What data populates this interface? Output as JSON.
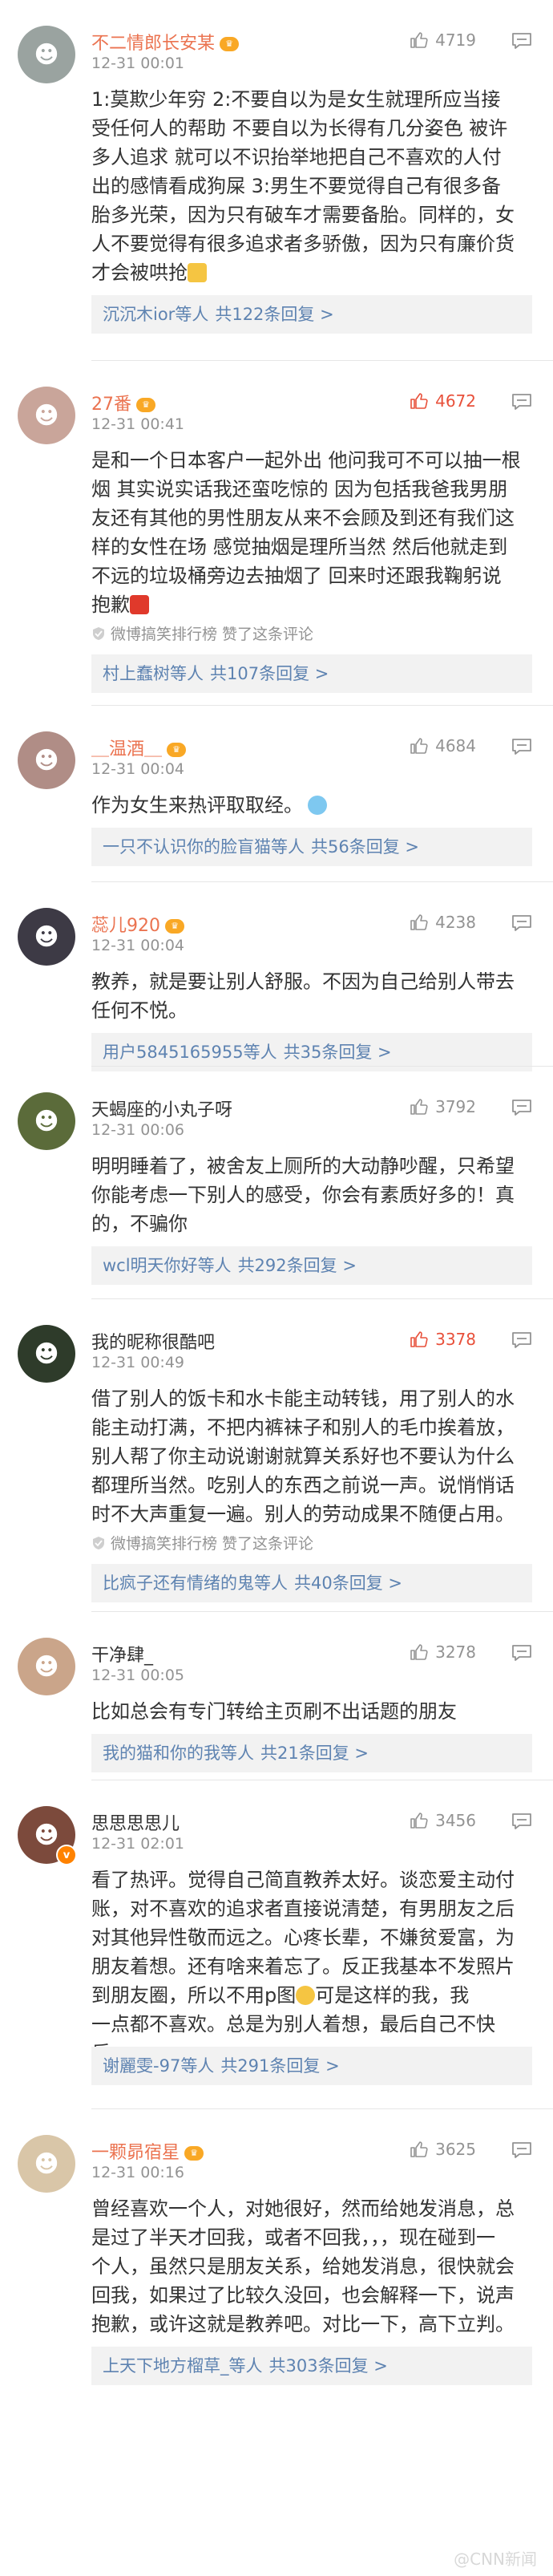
{
  "comments": [
    {
      "name": "不二情郎长安某",
      "time": "12-31 00:01",
      "likes": "4719",
      "hot": false,
      "name_color": "orange",
      "avatar_color": "#9aa3a0",
      "lines": [
        "1:莫欺少年穷   2:不要自以为是女生就理所应当接",
        "受任何人的帮助 不要自以为长得有几分姿色 被许",
        "多人追求 就可以不识抬举地把自己不喜欢的人付",
        "出的感情看成狗屎 3:男生不要觉得自己有很多备",
        "胎多光荣，因为只有破车才需要备胎。同样的，女",
        "人不要觉得有很多追求者多骄傲，因为只有廉价货",
        "才会被哄抢"
      ],
      "via": "",
      "reply_who": "沉沉木ior",
      "reply_mid": "等人",
      "reply_more": "共122条回复 >"
    },
    {
      "name": "27番",
      "time": "12-31 00:41",
      "likes": "4672",
      "hot": true,
      "name_color": "orange",
      "avatar_color": "#c9a59a",
      "lines": [
        "是和一个日本客户一起外出 他问我可不可以抽一根",
        "烟 其实说实话我还蛮吃惊的 因为包括我爸我男朋",
        "友还有其他的男性朋友从来不会顾及到还有我们这",
        "样的女性在场 感觉抽烟是理所当然 然后他就走到",
        "不远的垃圾桶旁边去抽烟了 回来时还跟我鞠躬说",
        "抱歉"
      ],
      "via": "微博搞笑排行榜 赞了这条评论",
      "reply_who": "村上蠢树",
      "reply_mid": "等人",
      "reply_more": "共107条回复 >"
    },
    {
      "name": "＿温酒＿",
      "time": "12-31 00:04",
      "likes": "4684",
      "hot": false,
      "name_color": "orange",
      "avatar_color": "#b08d86",
      "lines": [
        "作为女生来热评取取经。"
      ],
      "via": "",
      "reply_who": "一只不认识你的脸盲猫",
      "reply_mid": "等人",
      "reply_more": "共56条回复 >"
    },
    {
      "name": "蕊儿920",
      "time": "12-31 00:04",
      "likes": "4238",
      "hot": false,
      "name_color": "orange",
      "avatar_color": "#3d3a45",
      "lines": [
        "教养，就是要让别人舒服。不因为自己给别人带去",
        "任何不悦。"
      ],
      "via": "",
      "reply_who": "用户5845165955",
      "reply_mid": "等人",
      "reply_more": "共35条回复 >"
    },
    {
      "name": "天蝎座的小丸子呀",
      "time": "12-31 00:06",
      "likes": "3792",
      "hot": false,
      "name_color": "dark",
      "avatar_color": "#5b6b3a",
      "lines": [
        "明明睡着了，被舍友上厕所的大动静吵醒，只希望",
        "你能考虑一下别人的感受，你会有素质好多的！真",
        "的，不骗你"
      ],
      "via": "",
      "reply_who": "wcl明天你好",
      "reply_mid": "等人",
      "reply_more": "共292条回复 >"
    },
    {
      "name": "我的昵称很酷吧",
      "time": "12-31 00:49",
      "likes": "3378",
      "hot": true,
      "name_color": "dark",
      "avatar_color": "#2e3b2a",
      "lines": [
        "借了别人的饭卡和水卡能主动转钱，用了别人的水",
        "能主动打满，不把内裤袜子和别人的毛巾挨着放，",
        "别人帮了你主动说谢谢就算关系好也不要认为什么",
        "都理所当然。吃别人的东西之前说一声。说悄悄话",
        "时不大声重复一遍。别人的劳动成果不随便占用。"
      ],
      "via": "微博搞笑排行榜 赞了这条评论",
      "reply_who": "比疯子还有情绪的鬼",
      "reply_mid": "等人",
      "reply_more": "共40条回复 >"
    },
    {
      "name": "干净肆_",
      "time": "12-31 00:05",
      "likes": "3278",
      "hot": false,
      "name_color": "dark",
      "avatar_color": "#caa58a",
      "lines": [
        "比如总会有专门转给主页刷不出话题的朋友"
      ],
      "via": "",
      "reply_who": "我的猫和你的我",
      "reply_mid": "等人",
      "reply_more": "共21条回复 >"
    },
    {
      "name": "思思思思儿",
      "time": "12-31 02:01",
      "likes": "3456",
      "hot": false,
      "name_color": "dark",
      "avatar_color": "#7c4a3c",
      "lines": [
        "看了热评。觉得自己简直教养太好。谈恋爱主动付",
        "账，对不喜欢的追求者直接说清楚，有男朋友之后",
        "对其他异性敬而远之。心疼长辈，不嫌贫爱富，为",
        "朋友着想。还有啥来着忘了。反正我基本不发照片",
        "到朋友圈，所以不用p图",
        "一点都不喜欢。总是为别人着想，最后自己不快乐。"
      ],
      "line4_suffix": "可是这样的我，我",
      "via": "",
      "reply_who": "谢麗雯-97",
      "reply_mid": "等人",
      "reply_more": "共291条回复 >"
    },
    {
      "name": "一颗昴宿星",
      "time": "12-31 00:16",
      "likes": "3625",
      "hot": false,
      "name_color": "orange",
      "avatar_color": "#d9c6a8",
      "lines": [
        "曾经喜欢一个人，对她很好，然而给她发消息，总",
        "是过了半天才回我，或者不回我，，，现在碰到一",
        "个人，虽然只是朋友关系，给她发消息，很快就会",
        "回我，如果过了比较久没回，也会解释一下，说声",
        "抱歉，或许这就是教养吧。对比一下，高下立判。"
      ],
      "via": "",
      "reply_who": "上天下地方榴草_",
      "reply_mid": "等人",
      "reply_more": "共303条回复 >"
    }
  ],
  "watermark": "@CNN新闻"
}
